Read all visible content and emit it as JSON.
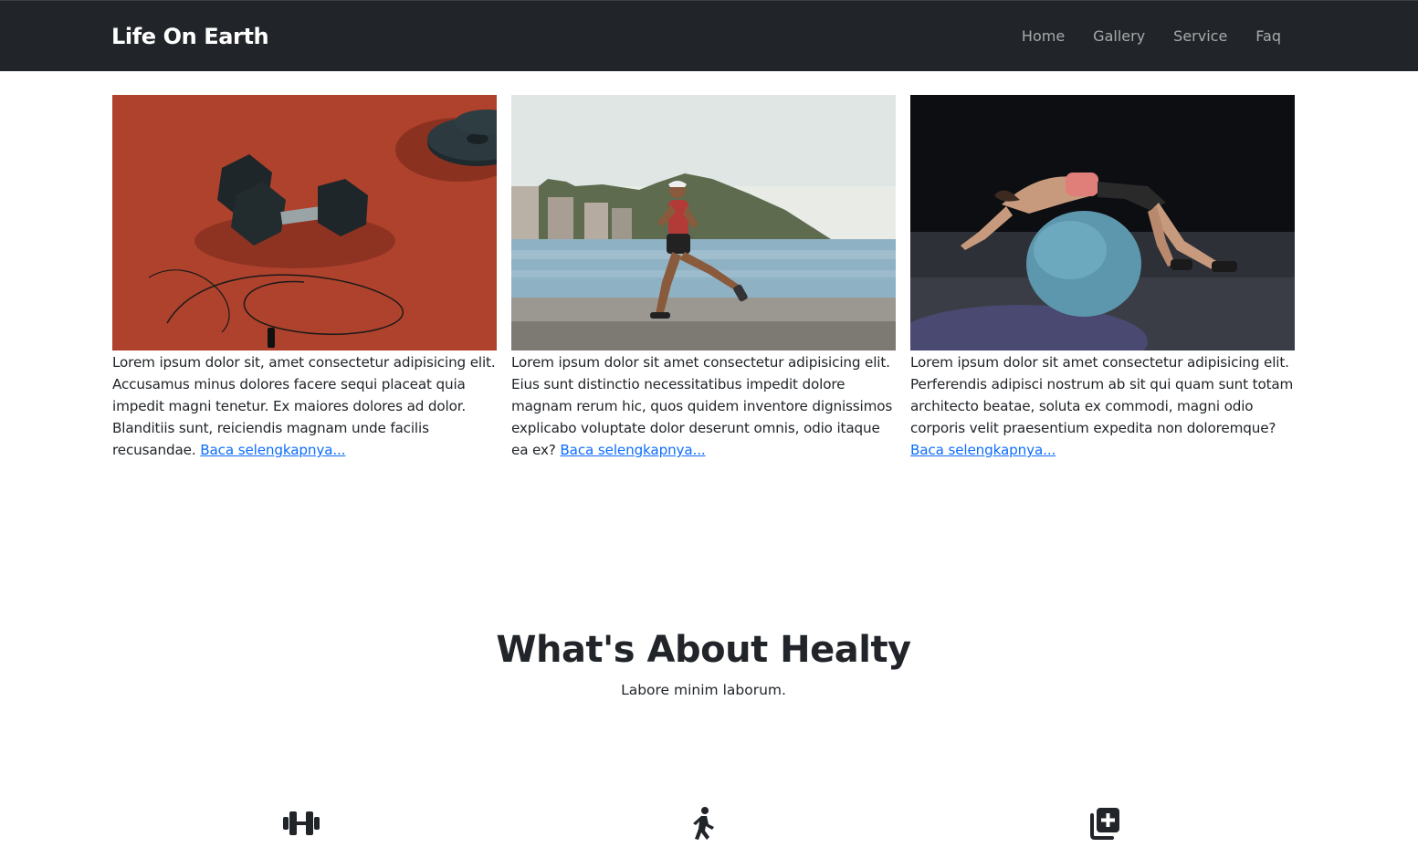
{
  "navbar": {
    "brand": "Life On Earth",
    "links": [
      "Home",
      "Gallery",
      "Service",
      "Faq"
    ]
  },
  "cards": [
    {
      "image": "dumbbells-and-jump-rope-on-running-track",
      "text": "Lorem ipsum dolor sit, amet consectetur adipisicing elit. Accusamus minus dolores facere sequi placeat quia impedit magni tenetur. Ex maiores dolores ad dolor. Blanditiis sunt, reiciendis magnam unde facilis recusandae.",
      "link": "Baca selengkapnya..."
    },
    {
      "image": "man-running-along-waterfront",
      "text": "Lorem ipsum dolor sit amet consectetur adipisicing elit. Eius sunt distinctio necessitatibus impedit dolore magnam rerum hic, quos quidem inventore dignissimos explicabo voluptate dolor deserunt omnis, odio itaque ea ex?",
      "link": "Baca selengkapnya..."
    },
    {
      "image": "woman-stretching-on-exercise-ball",
      "text": "Lorem ipsum dolor sit amet consectetur adipisicing elit. Perferendis adipisci nostrum ab sit qui quam sunt totam architecto beatae, soluta ex commodi, magni odio corporis velit praesentium expedita non doloremque?",
      "link": "Baca selengkapnya..."
    }
  ],
  "about": {
    "title": "What's About Healty",
    "subtitle": "Labore minim laborum."
  },
  "features": [
    {
      "icon": "dumbbell-icon"
    },
    {
      "icon": "walking-person-icon"
    },
    {
      "icon": "medical-plus-copy-icon"
    }
  ],
  "colors": {
    "navbar": "#212529",
    "link": "#0d6efd",
    "text": "#212529"
  }
}
